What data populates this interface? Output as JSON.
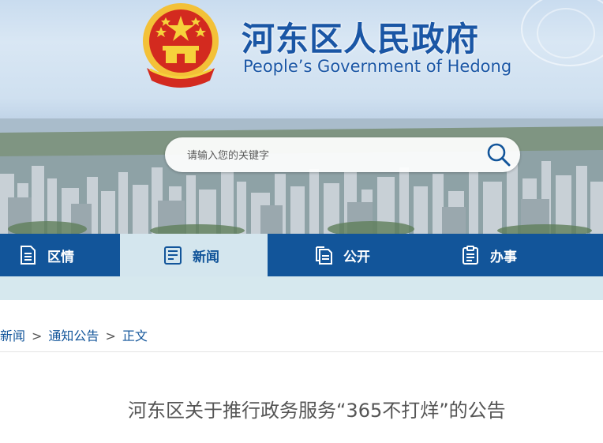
{
  "header": {
    "title_cn": "河东区人民政府",
    "title_en": "People’s Government of Hedong",
    "emblem_icon": "national-emblem-icon"
  },
  "search": {
    "placeholder": "请输入您的关键字",
    "button_icon": "search-icon"
  },
  "nav": {
    "items": [
      {
        "label": "区情",
        "icon": "document-icon",
        "active": false
      },
      {
        "label": "新闻",
        "icon": "news-icon",
        "active": true
      },
      {
        "label": "公开",
        "icon": "files-icon",
        "active": false
      },
      {
        "label": "办事",
        "icon": "clipboard-icon",
        "active": false
      }
    ]
  },
  "breadcrumb": {
    "items": [
      "新闻",
      "通知公告",
      "正文"
    ],
    "separator": ">"
  },
  "article": {
    "title": "河东区关于推行政务服务“365不打烊”的公告"
  },
  "colors": {
    "brand_blue": "#12559a",
    "title_blue": "#1a56a5",
    "active_tab_bg": "#d4e6ee"
  }
}
